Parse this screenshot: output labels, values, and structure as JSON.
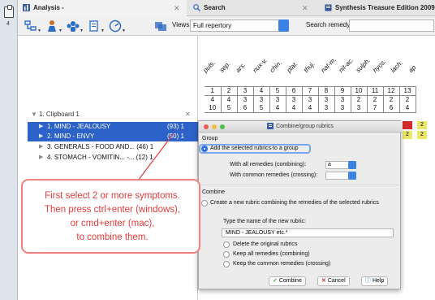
{
  "tabs": [
    {
      "label": "Analysis -",
      "close": "✕"
    },
    {
      "label": "Search",
      "close": "✕"
    },
    {
      "label": "Synthesis Treasure Edition 2009"
    }
  ],
  "left_strip": {
    "number": "4"
  },
  "toolbar": {
    "views_label": "Views:",
    "views_value": "Full repertory",
    "search_label": "Search remedy:",
    "search_value": ""
  },
  "remedies": [
    "puls.",
    "sep.",
    "ars.",
    "nux-v.",
    "chin.",
    "plat.",
    "thuj.",
    "nat-m.",
    "nit-ac.",
    "sulph.",
    "hyos.",
    "lach.",
    "ap"
  ],
  "grid_rows": [
    [
      "1",
      "2",
      "3",
      "4",
      "5",
      "6",
      "7",
      "8",
      "9",
      "10",
      "11",
      "12",
      "13"
    ],
    [
      "4",
      "4",
      "3",
      "3",
      "3",
      "3",
      "3",
      "3",
      "3",
      "2",
      "2",
      "2",
      "2"
    ],
    [
      "10",
      "5",
      "6",
      "5",
      "4",
      "4",
      "4",
      "3",
      "3",
      "3",
      "7",
      "6",
      "4"
    ]
  ],
  "clipboard": {
    "title": "1. Clipboard 1",
    "close": "✕",
    "items": [
      {
        "label": "1. MIND - JEALOUSY",
        "count": "(93) 1"
      },
      {
        "label": "2. MIND - ENVY",
        "count": "(50) 1"
      },
      {
        "label": "3. GENERALS - FOOD AND... (46) 1",
        "count": ""
      },
      {
        "label": "4. STOMACH - VOMITIN... -... (12) 1",
        "count": ""
      }
    ]
  },
  "badges": [
    "2",
    "2",
    "2"
  ],
  "dialog": {
    "title": "Combine/group rubrics",
    "group_label": "Group",
    "option_group": "Add the selected rubrics to a group",
    "all_remedies_label": "With all remedies (combining):",
    "all_remedies_value": "a",
    "common_remedies_label": "With common remedies (crossing):",
    "combine_label": "Combine",
    "option_combine": "Create a new rubric combining the remedies of the selected rubrics",
    "type_name_label": "Type the name of the new rubric:",
    "new_rubric_name": "MIND - JEALOUSY etc.*",
    "delete_original": "Delete the original rubrics",
    "keep_all": "Keep all remedies (combining)",
    "keep_common": "Keep the common remedies (crossing)",
    "btn_combine": "Combine",
    "btn_cancel": "Cancel",
    "btn_help": "Help"
  },
  "callout": {
    "lines": [
      "First select 2 or more symptoms.",
      "Then press ctrl+enter (windows),",
      "or cmd+enter (mac),",
      "to combine them."
    ]
  },
  "colors": {
    "selection_blue": "#2d62c9",
    "callout_red": "#e23b3b",
    "badge_red": "#d42b2b",
    "badge_yellow": "#e9e66a"
  }
}
